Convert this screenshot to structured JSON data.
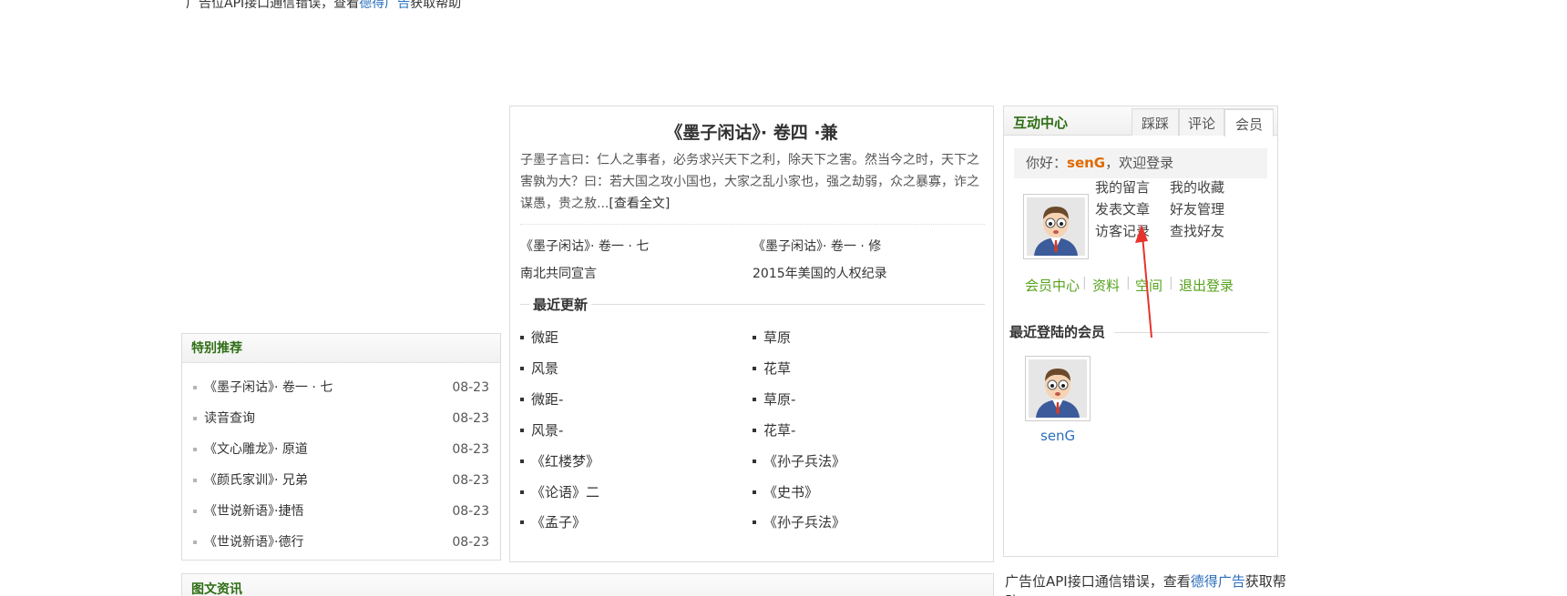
{
  "top_ad": {
    "prefix": "广告位API接口通信错误，查看",
    "link": "德得广告",
    "suffix": "获取帮助"
  },
  "special_recommend": {
    "title": "特别推荐",
    "items": [
      {
        "title": "《墨子闲诂》· 卷一 · 七",
        "date": "08-23"
      },
      {
        "title": "读音查询",
        "date": "08-23"
      },
      {
        "title": "《文心雕龙》· 原道",
        "date": "08-23"
      },
      {
        "title": "《颜氏家训》· 兄弟",
        "date": "08-23"
      },
      {
        "title": "《世说新语》·捷悟",
        "date": "08-23"
      },
      {
        "title": "《世说新语》·德行",
        "date": "08-23"
      }
    ]
  },
  "news": {
    "title": "图文资讯"
  },
  "featured": {
    "title": "《墨子闲诂》· 卷四 ·兼",
    "excerpt": "子墨子言曰：仁人之事者，必务求兴天下之利，除天下之害。然当今之时，天下之害孰为大？曰：若大国之攻小国也，大家之乱小家也，强之劫弱，众之暴寡，诈之谋愚，贵之敖...",
    "more_label": "[查看全文]",
    "links": [
      "《墨子闲诂》· 卷一 · 七",
      "《墨子闲诂》· 卷一 · 修",
      "南北共同宣言",
      "2015年美国的人权纪录"
    ]
  },
  "recent_updates": {
    "title": "最近更新",
    "left": [
      "微距",
      "风景",
      "微距-",
      "风景-",
      "《红楼梦》",
      "《论语》二",
      "《孟子》"
    ],
    "right": [
      "草原",
      "花草",
      "草原-",
      "花草-",
      "《孙子兵法》",
      "《史书》",
      "《孙子兵法》"
    ]
  },
  "interaction": {
    "title": "互动中心",
    "tabs": [
      "踩踩",
      "评论",
      "会员"
    ],
    "active_tab": "会员",
    "greeting_prefix": "你好：",
    "username": "senG",
    "greeting_suffix": "，欢迎登录",
    "member_links": [
      "我的留言",
      "我的收藏",
      "发表文章",
      "好友管理",
      "访客记录",
      "查找好友"
    ],
    "bottom_links": [
      "会员中心",
      "资料",
      "空间",
      "退出登录"
    ],
    "recent_members_title": "最近登陆的会员",
    "recent_members": [
      {
        "name": "senG"
      }
    ]
  },
  "right_ad": {
    "prefix": "广告位API接口通信错误，查看",
    "link": "德得广告",
    "suffix": "获取帮助"
  },
  "colors": {
    "heading_green": "#2e6e14",
    "link_green": "#56a21d",
    "username_orange": "#e06a00",
    "link_blue": "#2a6ebb",
    "annotation_arrow": "#e8322c"
  }
}
